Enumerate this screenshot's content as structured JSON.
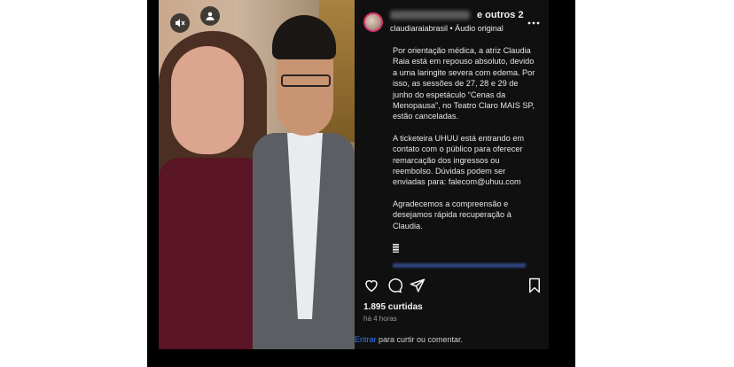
{
  "post": {
    "coauthors_suffix": "e outros 2",
    "audio_line": "claudiaraiabrasil • Áudio original",
    "more_icon": "more-horizontal-icon",
    "caption": [
      "Por orientação médica, a atriz Claudia Raia está em repouso absoluto, devido a uma laringite severa com edema. Por isso, as sessões de 27, 28 e 29 de junho do espetáculo “Cenas da Menopausa”, no Teatro Claro MAIS SP, estão canceladas.",
      "A ticketeira UHUU está entrando em contato com o público para oferecer remarcação dos ingressos ou reembolso. Dúvidas podem ser enviadas para: falecom@uhuu.com",
      "Agradecemos a compreensão e desejamos rápida recuperação à Claudia."
    ],
    "likes": "1.895 curtidas",
    "time_ago": "há 4 horas",
    "login_prompt": {
      "link": "Entrar",
      "rest": " para curtir ou comentar."
    }
  },
  "icons": {
    "mute": "speaker-muted-icon",
    "tag": "user-tag-icon",
    "like": "heart-icon",
    "comment": "comment-icon",
    "share": "send-icon",
    "save": "bookmark-icon"
  },
  "colors": {
    "panel_bg": "#101010",
    "link": "#2f7bf0",
    "muted_text": "#9a9a9a"
  }
}
